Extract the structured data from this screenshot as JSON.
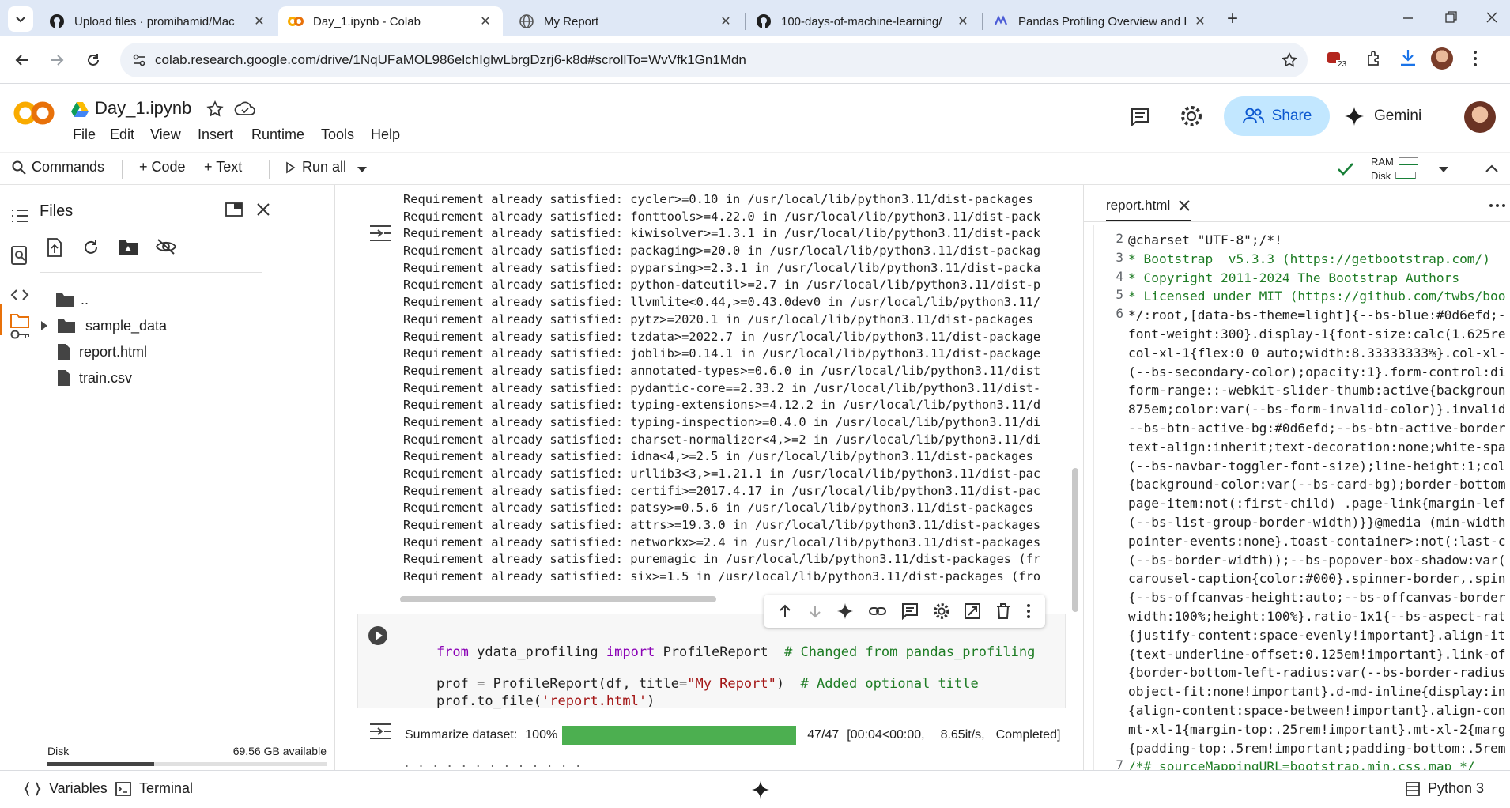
{
  "browser": {
    "tabs": [
      {
        "title": "Upload files · promihamid/Mac",
        "icon": "github-icon"
      },
      {
        "title": "Day_1.ipynb - Colab",
        "icon": "colab-icon"
      },
      {
        "title": "My Report",
        "icon": "globe-icon"
      },
      {
        "title": "100-days-of-machine-learning/",
        "icon": "github-icon"
      },
      {
        "title": "Pandas Profiling Overview and I",
        "icon": "pandas-icon"
      }
    ],
    "url": "colab.research.google.com/drive/1NqUFaMOL986elchIglwLbrgDzrj6-k8d#scrollTo=WvVfk1Gn1Mdn",
    "extension_badge": "23"
  },
  "colab": {
    "notebook_title": "Day_1.ipynb",
    "menu": [
      "File",
      "Edit",
      "View",
      "Insert",
      "Runtime",
      "Tools",
      "Help"
    ],
    "share_label": "Share",
    "gemini_label": "Gemini",
    "toolbar": {
      "commands": "Commands",
      "code": "+ Code",
      "text": "+ Text",
      "run_all": "Run all"
    },
    "resources": {
      "ram": "RAM",
      "disk": "Disk"
    }
  },
  "files_panel": {
    "title": "Files",
    "items": [
      {
        "name": "..",
        "type": "folder"
      },
      {
        "name": "sample_data",
        "type": "folder"
      },
      {
        "name": "report.html",
        "type": "file"
      },
      {
        "name": "train.csv",
        "type": "file"
      }
    ],
    "disk_label": "Disk",
    "disk_available": "69.56 GB available",
    "disk_used_fraction": 0.38
  },
  "output_lines": [
    "Requirement already satisfied: cycler>=0.10 in /usr/local/lib/python3.11/dist-packages",
    "Requirement already satisfied: fonttools>=4.22.0 in /usr/local/lib/python3.11/dist-pack",
    "Requirement already satisfied: kiwisolver>=1.3.1 in /usr/local/lib/python3.11/dist-pack",
    "Requirement already satisfied: packaging>=20.0 in /usr/local/lib/python3.11/dist-packag",
    "Requirement already satisfied: pyparsing>=2.3.1 in /usr/local/lib/python3.11/dist-packa",
    "Requirement already satisfied: python-dateutil>=2.7 in /usr/local/lib/python3.11/dist-p",
    "Requirement already satisfied: llvmlite<0.44,>=0.43.0dev0 in /usr/local/lib/python3.11/",
    "Requirement already satisfied: pytz>=2020.1 in /usr/local/lib/python3.11/dist-packages",
    "Requirement already satisfied: tzdata>=2022.7 in /usr/local/lib/python3.11/dist-package",
    "Requirement already satisfied: joblib>=0.14.1 in /usr/local/lib/python3.11/dist-package",
    "Requirement already satisfied: annotated-types>=0.6.0 in /usr/local/lib/python3.11/dist",
    "Requirement already satisfied: pydantic-core==2.33.2 in /usr/local/lib/python3.11/dist-",
    "Requirement already satisfied: typing-extensions>=4.12.2 in /usr/local/lib/python3.11/d",
    "Requirement already satisfied: typing-inspection>=0.4.0 in /usr/local/lib/python3.11/di",
    "Requirement already satisfied: charset-normalizer<4,>=2 in /usr/local/lib/python3.11/di",
    "Requirement already satisfied: idna<4,>=2.5 in /usr/local/lib/python3.11/dist-packages",
    "Requirement already satisfied: urllib3<3,>=1.21.1 in /usr/local/lib/python3.11/dist-pac",
    "Requirement already satisfied: certifi>=2017.4.17 in /usr/local/lib/python3.11/dist-pac",
    "Requirement already satisfied: patsy>=0.5.6 in /usr/local/lib/python3.11/dist-packages",
    "Requirement already satisfied: attrs>=19.3.0 in /usr/local/lib/python3.11/dist-packages",
    "Requirement already satisfied: networkx>=2.4 in /usr/local/lib/python3.11/dist-packages",
    "Requirement already satisfied: puremagic in /usr/local/lib/python3.11/dist-packages (fr",
    "Requirement already satisfied: six>=1.5 in /usr/local/lib/python3.11/dist-packages (fro"
  ],
  "code_cell": {
    "line1": {
      "kw1": "from",
      "mod": " ydata_profiling ",
      "kw2": "import",
      "cls": " ProfileReport  ",
      "comment": "# Changed from pandas_profiling"
    },
    "line2": {
      "a": "prof = ProfileReport(df, title=",
      "s": "\"My Report\"",
      "b": ")  ",
      "comment": "# Added optional title"
    },
    "line3": {
      "a": "prof.to_file(",
      "s": "'report.html'",
      "b": ")"
    }
  },
  "progress": {
    "label": "Summarize dataset:",
    "percent_text": "100%",
    "fraction": 1.0,
    "counts": "47/47",
    "timing": "[00:04<00:00,",
    "rate": "8.65it/s,",
    "status": "Completed]",
    "color": "#4caf50"
  },
  "editor": {
    "tab_title": "report.html",
    "lines": [
      {
        "n": "2",
        "t": "@charset \"UTF-8\";/*!"
      },
      {
        "n": "3",
        "t": "* Bootstrap  v5.3.3 (https://getbootstrap.com/)"
      },
      {
        "n": "4",
        "t": "* Copyright 2011-2024 The Bootstrap Authors"
      },
      {
        "n": "5",
        "t": "* Licensed under MIT (https://github.com/twbs/boo"
      },
      {
        "n": "6",
        "t": "*/:root,[data-bs-theme=light]{--bs-blue:#0d6efd;-"
      },
      {
        "n": "",
        "t": "font-weight:300}.display-1{font-size:calc(1.625re"
      },
      {
        "n": "",
        "t": "col-xl-1{flex:0 0 auto;width:8.33333333%}.col-xl-"
      },
      {
        "n": "",
        "t": "(--bs-secondary-color);opacity:1}.form-control:di"
      },
      {
        "n": "",
        "t": "form-range::-webkit-slider-thumb:active{backgroun"
      },
      {
        "n": "",
        "t": "875em;color:var(--bs-form-invalid-color)}.invalid"
      },
      {
        "n": "",
        "t": "--bs-btn-active-bg:#0d6efd;--bs-btn-active-border"
      },
      {
        "n": "",
        "t": "text-align:inherit;text-decoration:none;white-spa"
      },
      {
        "n": "",
        "t": "(--bs-navbar-toggler-font-size);line-height:1;col"
      },
      {
        "n": "",
        "t": "{background-color:var(--bs-card-bg);border-bottom"
      },
      {
        "n": "",
        "t": "page-item:not(:first-child) .page-link{margin-lef"
      },
      {
        "n": "",
        "t": "(--bs-list-group-border-width)}}@media (min-width"
      },
      {
        "n": "",
        "t": "pointer-events:none}.toast-container>:not(:last-c"
      },
      {
        "n": "",
        "t": "(--bs-border-width));--bs-popover-box-shadow:var("
      },
      {
        "n": "",
        "t": "carousel-caption{color:#000}.spinner-border,.spin"
      },
      {
        "n": "",
        "t": "{--bs-offcanvas-height:auto;--bs-offcanvas-border"
      },
      {
        "n": "",
        "t": "width:100%;height:100%}.ratio-1x1{--bs-aspect-rat"
      },
      {
        "n": "",
        "t": "{justify-content:space-evenly!important}.align-it"
      },
      {
        "n": "",
        "t": "{text-underline-offset:0.125em!important}.link-of"
      },
      {
        "n": "",
        "t": "{border-bottom-left-radius:var(--bs-border-radius"
      },
      {
        "n": "",
        "t": "object-fit:none!important}.d-md-inline{display:in"
      },
      {
        "n": "",
        "t": "{align-content:space-between!important}.align-con"
      },
      {
        "n": "",
        "t": "mt-xl-1{margin-top:.25rem!important}.mt-xl-2{marg"
      },
      {
        "n": "",
        "t": "{padding-top:.5rem!important;padding-bottom:.5rem"
      },
      {
        "n": "7",
        "t": "/*# sourceMappingURL=bootstrap.min.css.map */"
      }
    ]
  },
  "statusbar": {
    "variables": "Variables",
    "terminal": "Terminal",
    "runtime": "Python 3"
  }
}
